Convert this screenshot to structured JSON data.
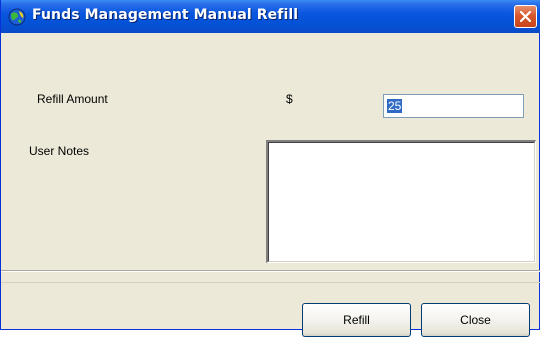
{
  "window": {
    "title": "Funds Management Manual Refill",
    "title_icon": "globe-icon",
    "close_icon": "close-icon",
    "colors": {
      "titlebar": "#0452d6",
      "close_button": "#d8582e",
      "background": "#ece9d8",
      "selection": "#316ac5"
    }
  },
  "form": {
    "refill_amount_label": "Refill Amount",
    "currency_symbol": "$",
    "refill_amount_value": "25",
    "user_notes_label": "User Notes",
    "user_notes_value": ""
  },
  "buttons": {
    "refill_label": "Refill",
    "close_label": "Close"
  }
}
